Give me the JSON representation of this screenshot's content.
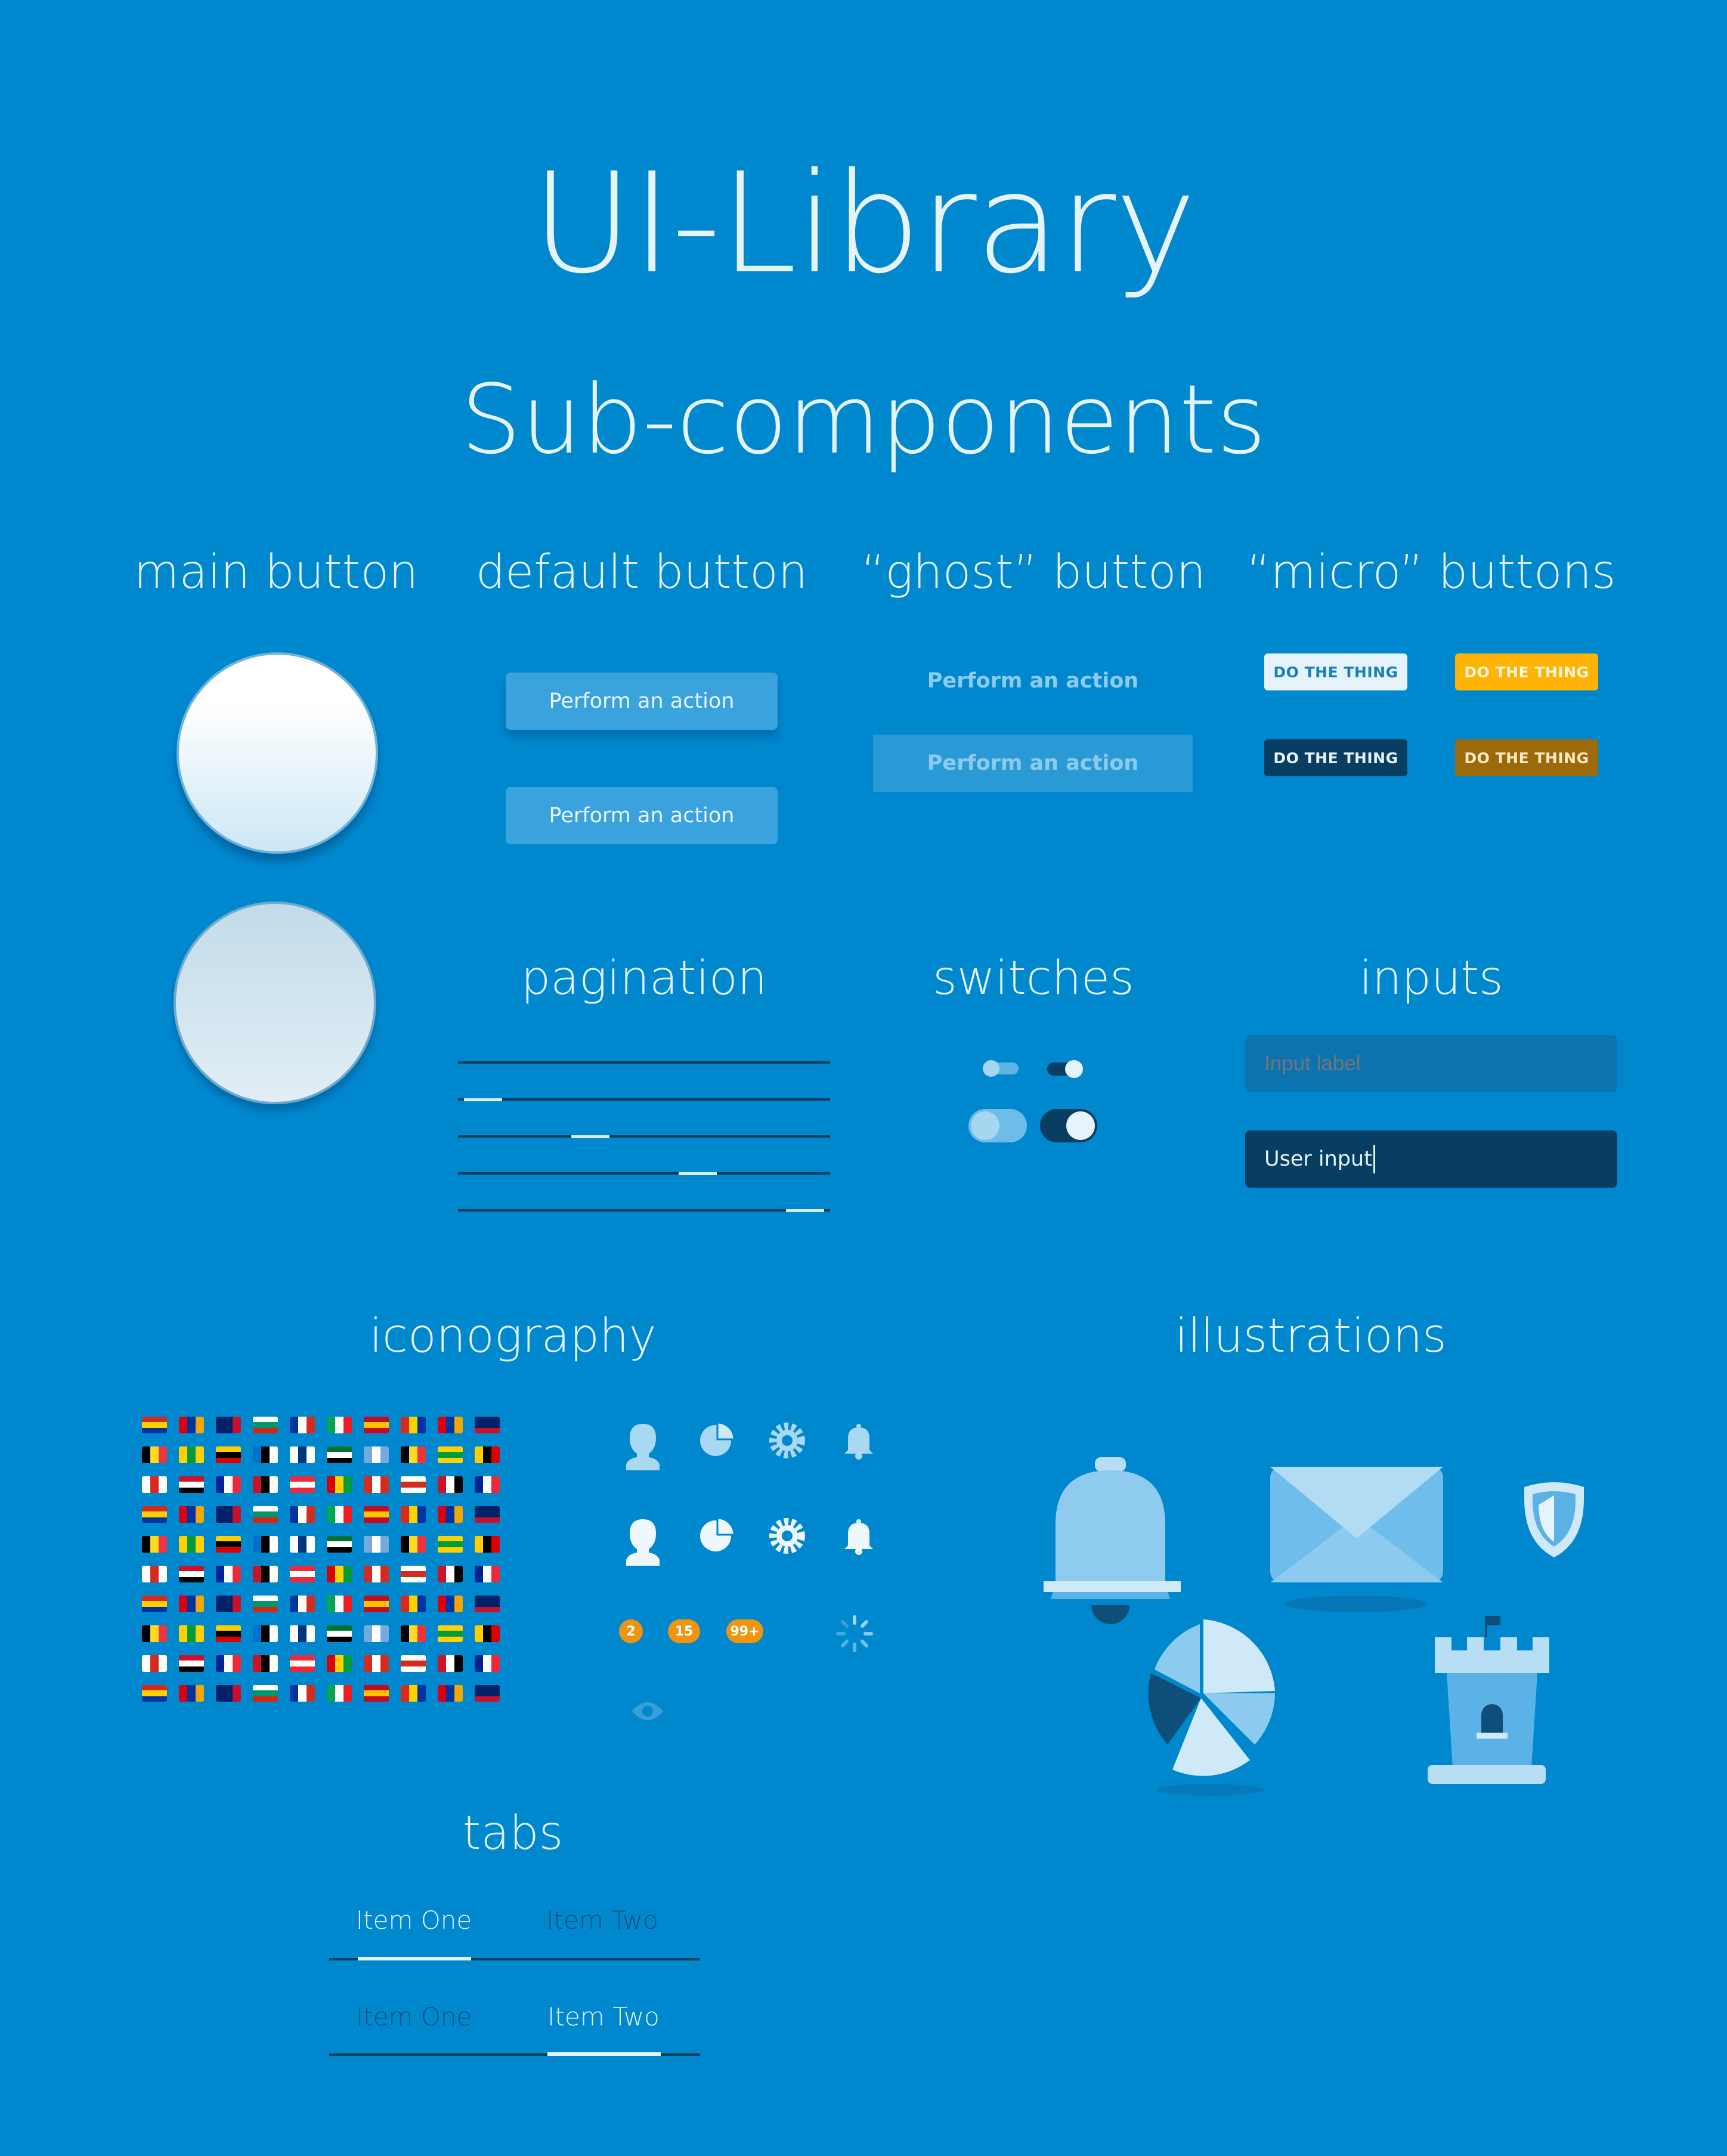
{
  "header": {
    "title": "UI-Library",
    "subtitle": "Sub-components"
  },
  "sections": {
    "main_button": "main button",
    "default_button": "default button",
    "ghost_button": "“ghost” button",
    "micro_buttons": "“micro” buttons",
    "pagination": "pagination",
    "switches": "switches",
    "inputs": "inputs",
    "iconography": "iconography",
    "illustrations": "illustrations",
    "tabs": "tabs"
  },
  "default_buttons": [
    "Perform an action",
    "Perform an action"
  ],
  "ghost_buttons": [
    "Perform an action",
    "Perform an action"
  ],
  "micro_buttons": [
    "DO THE THING",
    "DO THE THING",
    "DO THE THING",
    "DO THE THING"
  ],
  "inputs": {
    "label_placeholder": "Input label",
    "user_value": "User input"
  },
  "badges": [
    "2",
    "15",
    "99+"
  ],
  "tabs": [
    {
      "items": [
        "Item One",
        "Item Two"
      ],
      "active": 0
    },
    {
      "items": [
        "Item One",
        "Item Two"
      ],
      "active": 1
    }
  ],
  "colors": {
    "background": "#0088cf",
    "micro_light": "#e6f3fb",
    "micro_yellow": "#ffb405",
    "micro_dark": "#083e61",
    "micro_brown": "#9c6a0b",
    "badge": "#f0940e"
  },
  "icons": [
    "person-icon",
    "pie-chart-icon",
    "gear-icon",
    "bell-icon",
    "eye-icon",
    "spinner-icon"
  ],
  "illustrations": [
    "bell-illustration",
    "envelope-illustration",
    "shield-illustration",
    "pie-chart-illustration",
    "tower-illustration"
  ]
}
